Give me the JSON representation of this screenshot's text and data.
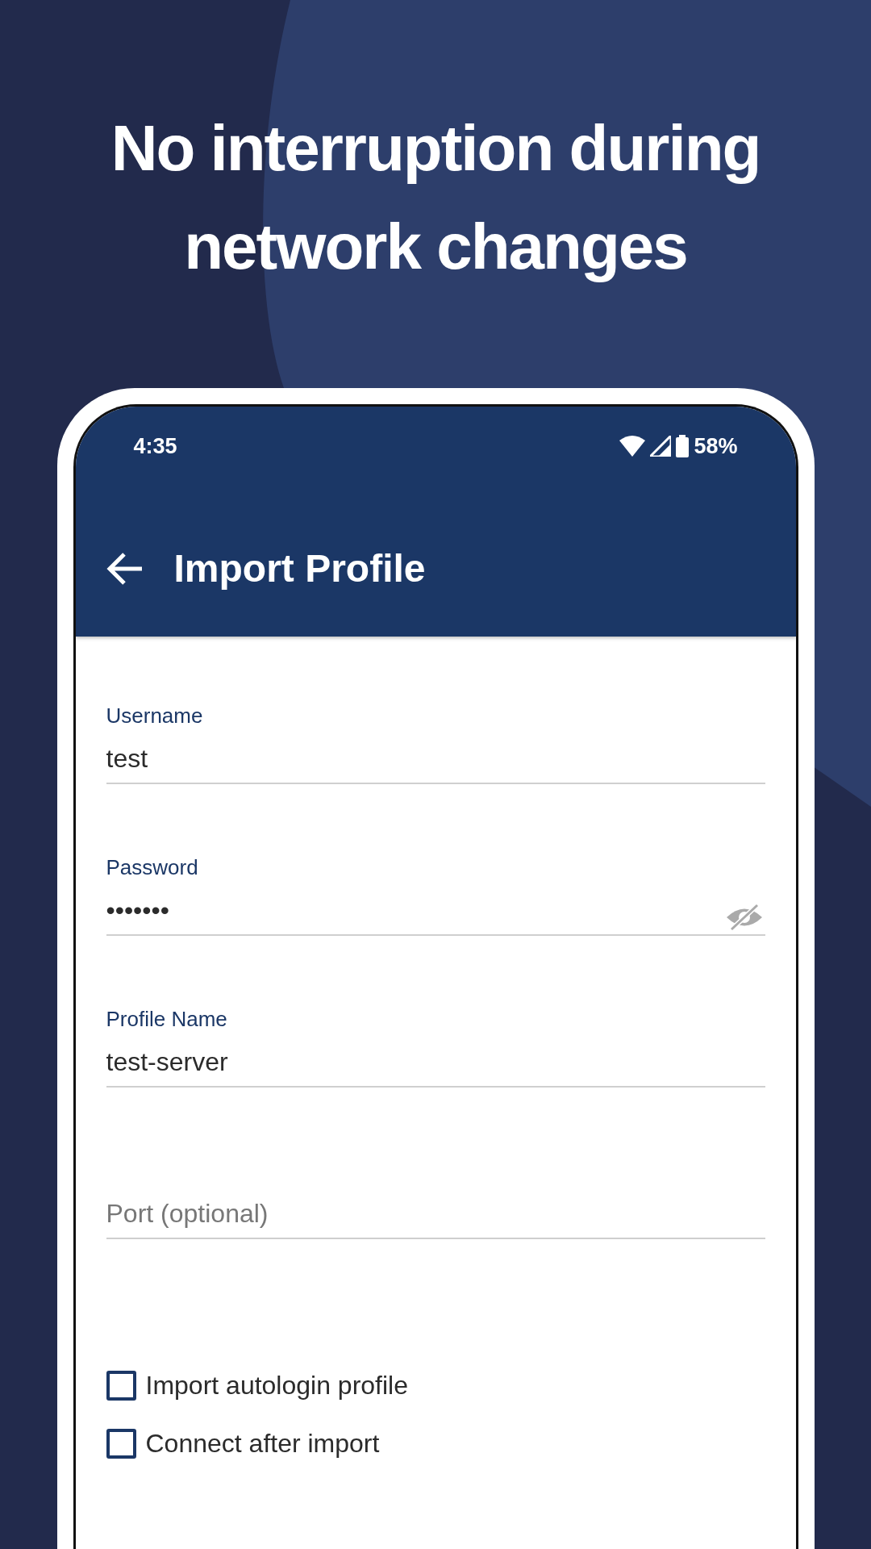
{
  "headline": [
    "No interruption during",
    "network changes"
  ],
  "status_bar": {
    "time": "4:35",
    "battery": "58%"
  },
  "app_bar": {
    "title": "Import Profile"
  },
  "fields": [
    {
      "kind": "text",
      "label": "Username",
      "value": "test"
    },
    {
      "kind": "password",
      "label": "Password",
      "value": "•••••••"
    },
    {
      "kind": "text",
      "label": "Profile Name",
      "value": "test-server"
    },
    {
      "kind": "text",
      "placeholder": "Port (optional)"
    }
  ],
  "checkboxes": [
    {
      "label": "Import autologin profile",
      "checked": false
    },
    {
      "label": "Connect after import",
      "checked": false
    }
  ]
}
